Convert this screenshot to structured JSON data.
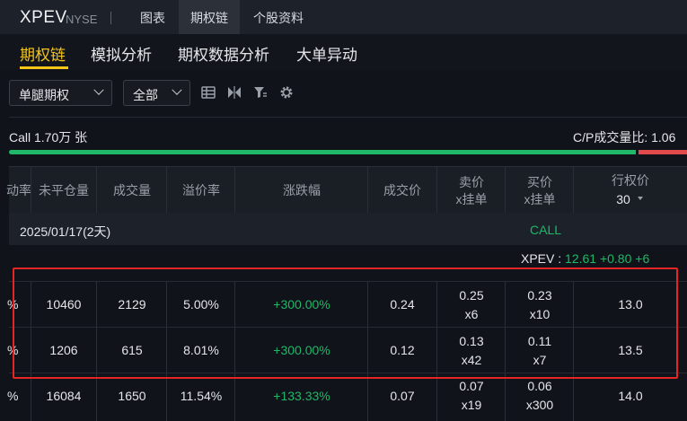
{
  "header": {
    "ticker": "XPEV",
    "exchange": "NYSE",
    "tabs": [
      {
        "label": "图表"
      },
      {
        "label": "期权链"
      },
      {
        "label": "个股资料"
      }
    ]
  },
  "subtabs": [
    {
      "label": "期权链"
    },
    {
      "label": "模拟分析"
    },
    {
      "label": "期权数据分析"
    },
    {
      "label": "大单异动"
    }
  ],
  "filters": {
    "strategy": "单腿期权",
    "scope": "全部"
  },
  "icons": [
    "list-icon",
    "split-view-icon",
    "filter-icon",
    "settings-gear-icon"
  ],
  "volume": {
    "call_label": "Call 1.70万 张",
    "cp_ratio_label": "C/P成交量比: 1.06",
    "call_fraction": 0.93
  },
  "table": {
    "headers": {
      "c0": "动率",
      "c1": "未平仓量",
      "c2": "成交量",
      "c3": "溢价率",
      "c4": "涨跌幅",
      "c5": "成交价",
      "c6a": "卖价",
      "c6b": "x挂单",
      "c7a": "买价",
      "c7b": "x挂单",
      "c8a": "行权价",
      "c8b": "30"
    },
    "expiry": "2025/01/17(2天)",
    "side_label": "CALL",
    "underlying": {
      "name": "XPEV :",
      "change": "12.61 +0.80 +6"
    },
    "rows": [
      {
        "iv": "%",
        "oi": "10460",
        "vol": "2129",
        "premium": "5.00%",
        "chg": "+300.00%",
        "last": "0.24",
        "ask": "0.25",
        "ask_size": "x6",
        "bid": "0.23",
        "bid_size": "x10",
        "strike": "13.0"
      },
      {
        "iv": "%",
        "oi": "1206",
        "vol": "615",
        "premium": "8.01%",
        "chg": "+300.00%",
        "last": "0.12",
        "ask": "0.13",
        "ask_size": "x42",
        "bid": "0.11",
        "bid_size": "x7",
        "strike": "13.5"
      },
      {
        "iv": "%",
        "oi": "16084",
        "vol": "1650",
        "premium": "11.54%",
        "chg": "+133.33%",
        "last": "0.07",
        "ask": "0.07",
        "ask_size": "x19",
        "bid": "0.06",
        "bid_size": "x300",
        "strike": "14.0"
      }
    ]
  },
  "colors": {
    "accent": "#f5c518",
    "up": "#1fb868",
    "down": "#e14a4a",
    "highlight_box": "#e52424"
  }
}
